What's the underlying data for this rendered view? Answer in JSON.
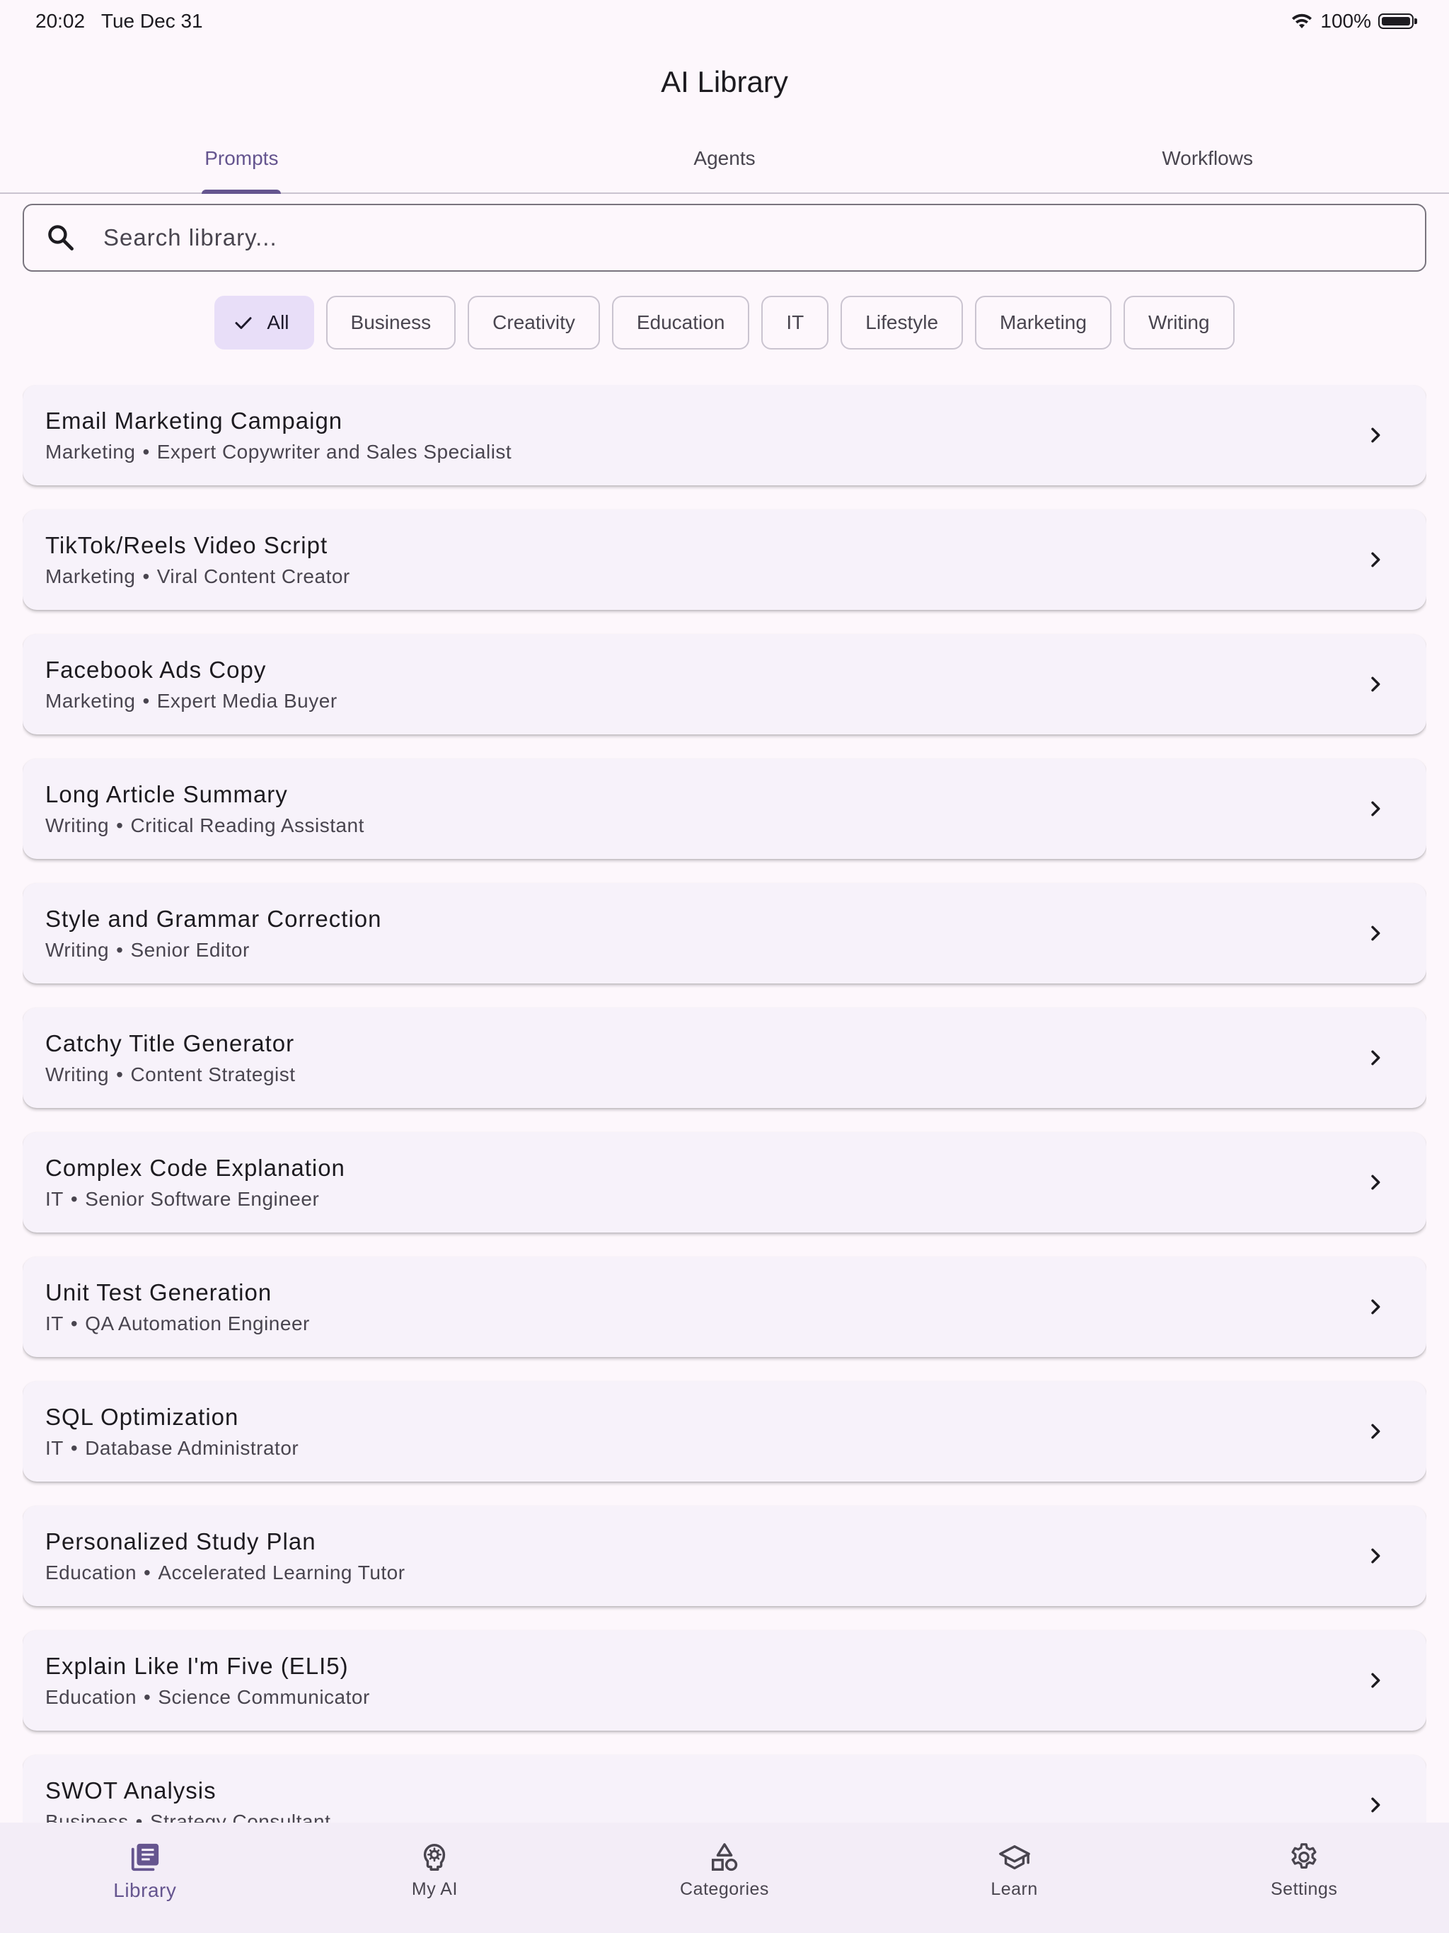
{
  "status_bar": {
    "time": "20:02",
    "date": "Tue Dec 31",
    "battery": "100%"
  },
  "app": {
    "title": "AI Library"
  },
  "tabs": [
    {
      "label": "Prompts",
      "active": true
    },
    {
      "label": "Agents",
      "active": false
    },
    {
      "label": "Workflows",
      "active": false
    }
  ],
  "search": {
    "placeholder": "Search library..."
  },
  "filters": [
    {
      "label": "All",
      "selected": true
    },
    {
      "label": "Business"
    },
    {
      "label": "Creativity"
    },
    {
      "label": "Education"
    },
    {
      "label": "IT"
    },
    {
      "label": "Lifestyle"
    },
    {
      "label": "Marketing"
    },
    {
      "label": "Writing"
    }
  ],
  "items": [
    {
      "title": "Email Marketing Campaign",
      "category": "Marketing",
      "role": "Expert Copywriter and Sales Specialist"
    },
    {
      "title": "TikTok/Reels Video Script",
      "category": "Marketing",
      "role": "Viral Content Creator"
    },
    {
      "title": "Facebook Ads Copy",
      "category": "Marketing",
      "role": "Expert Media Buyer"
    },
    {
      "title": "Long Article Summary",
      "category": "Writing",
      "role": "Critical Reading Assistant"
    },
    {
      "title": "Style and Grammar Correction",
      "category": "Writing",
      "role": "Senior Editor"
    },
    {
      "title": "Catchy Title Generator",
      "category": "Writing",
      "role": "Content Strategist"
    },
    {
      "title": "Complex Code Explanation",
      "category": "IT",
      "role": "Senior Software Engineer"
    },
    {
      "title": "Unit Test Generation",
      "category": "IT",
      "role": "QA Automation Engineer"
    },
    {
      "title": "SQL Optimization",
      "category": "IT",
      "role": "Database Administrator"
    },
    {
      "title": "Personalized Study Plan",
      "category": "Education",
      "role": "Accelerated Learning Tutor"
    },
    {
      "title": "Explain Like I'm Five (ELI5)",
      "category": "Education",
      "role": "Science Communicator"
    },
    {
      "title": "SWOT Analysis",
      "category": "Business",
      "role": "Strategy Consultant"
    }
  ],
  "separator": "•",
  "bottom_nav": [
    {
      "label": "Library",
      "icon": "library-icon",
      "active": true
    },
    {
      "label": "My AI",
      "icon": "brain-icon",
      "active": false
    },
    {
      "label": "Categories",
      "icon": "categories-icon",
      "active": false
    },
    {
      "label": "Learn",
      "icon": "graduation-cap-icon",
      "active": false
    },
    {
      "label": "Settings",
      "icon": "gear-icon",
      "active": false
    }
  ],
  "colors": {
    "accent": "#65558f",
    "background": "#fdf7fc",
    "card": "#f7f2fa",
    "chip_selected": "#e8def8"
  }
}
